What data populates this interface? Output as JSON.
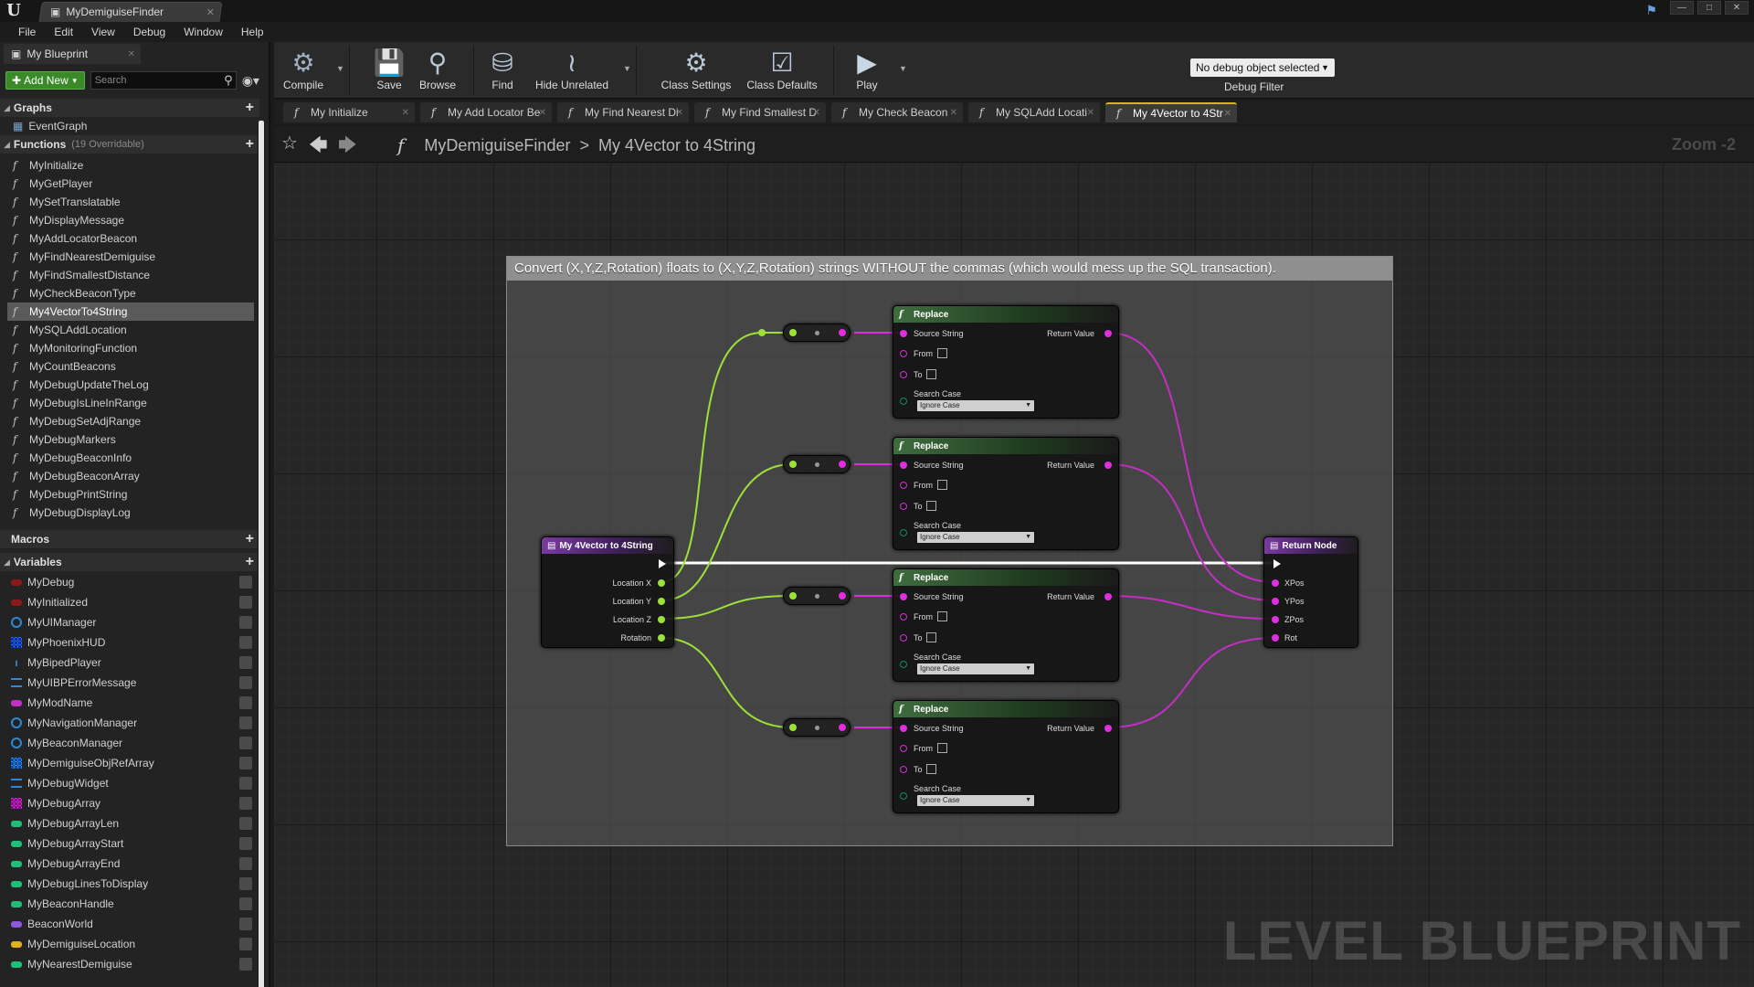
{
  "window": {
    "doc_tab": "MyDemiguiseFinder",
    "controls": [
      "—",
      "□",
      "✕"
    ]
  },
  "menu": [
    "File",
    "Edit",
    "View",
    "Debug",
    "Window",
    "Help"
  ],
  "left_panel": {
    "tab": "My Blueprint",
    "add_new": "Add New",
    "search_placeholder": "Search",
    "graphs_label": "Graphs",
    "event_graph": "EventGraph",
    "functions_label": "Functions",
    "functions_count": "(19 Overridable)",
    "functions": [
      "MyInitialize",
      "MyGetPlayer",
      "MySetTranslatable",
      "MyDisplayMessage",
      "MyAddLocatorBeacon",
      "MyFindNearestDemiguise",
      "MyFindSmallestDistance",
      "MyCheckBeaconType",
      "My4VectorTo4String",
      "MySQLAddLocation",
      "MyMonitoringFunction",
      "MyCountBeacons",
      "MyDebugUpdateTheLog",
      "MyDebugIsLineInRange",
      "MyDebugSetAdjRange",
      "MyDebugMarkers",
      "MyDebugBeaconInfo",
      "MyDebugBeaconArray",
      "MyDebugPrintString",
      "MyDebugDisplayLog"
    ],
    "selected_function": "My4VectorTo4String",
    "macros_label": "Macros",
    "variables_label": "Variables",
    "variables": [
      {
        "name": "MyDebug",
        "color": "#8a1a1a",
        "kind": "pill"
      },
      {
        "name": "MyInitialized",
        "color": "#8a1a1a",
        "kind": "pill"
      },
      {
        "name": "MyUIManager",
        "color": "#2a8ad8",
        "kind": "ring"
      },
      {
        "name": "MyPhoenixHUD",
        "color": "#2a6ad8",
        "kind": "grid"
      },
      {
        "name": "MyBipedPlayer",
        "color": "#2a8ad8",
        "kind": "figure"
      },
      {
        "name": "MyUIBPErrorMessage",
        "color": "#2a8ad8",
        "kind": "lines"
      },
      {
        "name": "MyModName",
        "color": "#c22fc2",
        "kind": "pill"
      },
      {
        "name": "MyNavigationManager",
        "color": "#2a8ad8",
        "kind": "ring"
      },
      {
        "name": "MyBeaconManager",
        "color": "#2a8ad8",
        "kind": "ring"
      },
      {
        "name": "MyDemiguiseObjRefArray",
        "color": "#2a8ad8",
        "kind": "grid"
      },
      {
        "name": "MyDebugWidget",
        "color": "#2a8ad8",
        "kind": "lines"
      },
      {
        "name": "MyDebugArray",
        "color": "#c22fc2",
        "kind": "grid"
      },
      {
        "name": "MyDebugArrayLen",
        "color": "#1fbf7a",
        "kind": "pill"
      },
      {
        "name": "MyDebugArrayStart",
        "color": "#1fbf7a",
        "kind": "pill"
      },
      {
        "name": "MyDebugArrayEnd",
        "color": "#1fbf7a",
        "kind": "pill"
      },
      {
        "name": "MyDebugLinesToDisplay",
        "color": "#1fbf7a",
        "kind": "pill"
      },
      {
        "name": "MyBeaconHandle",
        "color": "#1fbf7a",
        "kind": "pill"
      },
      {
        "name": "BeaconWorld",
        "color": "#8a5ad8",
        "kind": "pill"
      },
      {
        "name": "MyDemiguiseLocation",
        "color": "#e0b020",
        "kind": "pill"
      },
      {
        "name": "MyNearestDemiguise",
        "color": "#1fbf7a",
        "kind": "pill"
      }
    ]
  },
  "toolbar": {
    "compile": "Compile",
    "save": "Save",
    "browse": "Browse",
    "find": "Find",
    "hide_unrelated": "Hide Unrelated",
    "class_settings": "Class Settings",
    "class_defaults": "Class Defaults",
    "play": "Play",
    "debug_select": "No debug object selected",
    "debug_filter": "Debug Filter"
  },
  "graph_tabs": [
    "My Initialize",
    "My Add Locator Be",
    "My Find Nearest Di",
    "My Find Smallest D",
    "My Check Beacon",
    "My SQLAdd Locati",
    "My 4Vector to 4Str"
  ],
  "breadcrumb": {
    "blueprint": "MyDemiguiseFinder",
    "separator": ">",
    "function": "My 4Vector to 4String"
  },
  "zoom": "Zoom -2",
  "watermark": "LEVEL BLUEPRINT",
  "comment": "Convert (X,Y,Z,Rotation) floats to (X,Y,Z,Rotation) strings WITHOUT the commas (which would mess up the SQL transaction).",
  "entry_node": {
    "title": "My 4Vector to 4String",
    "pins": [
      "Location X",
      "Location Y",
      "Location Z",
      "Rotation"
    ]
  },
  "replace_node": {
    "title": "Replace",
    "source": "Source String",
    "from": "From",
    "to": "To",
    "search_case": "Search Case",
    "search_case_value": "Ignore Case",
    "return_value": "Return Value"
  },
  "return_node": {
    "title": "Return Node",
    "pins": [
      "XPos",
      "YPos",
      "ZPos",
      "Rot"
    ]
  },
  "colors": {
    "float_pin": "#9ee03a",
    "string_pin": "#e02fe0",
    "exec_pin": "#ffffff"
  }
}
